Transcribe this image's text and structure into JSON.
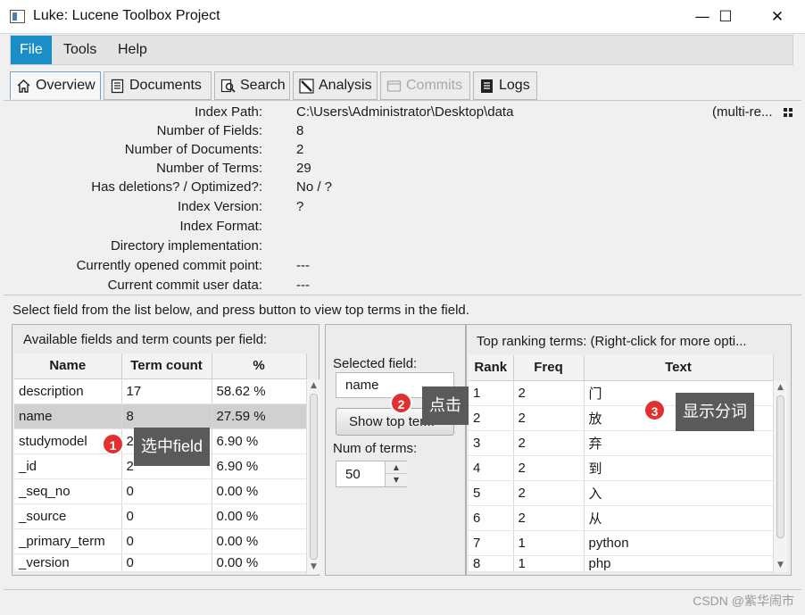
{
  "window": {
    "title": "Luke: Lucene Toolbox Project",
    "minimize_glyph": "—",
    "maximize_glyph": "☐",
    "close_glyph": "✕"
  },
  "menu": {
    "items": [
      {
        "label": "File",
        "active": true
      },
      {
        "label": "Tools"
      },
      {
        "label": "Help"
      }
    ]
  },
  "tabs": [
    {
      "label": "Overview",
      "icon": "home-icon",
      "selected": true
    },
    {
      "label": "Documents",
      "icon": "document-icon"
    },
    {
      "label": "Search",
      "icon": "search-icon"
    },
    {
      "label": "Analysis",
      "icon": "wand-icon"
    },
    {
      "label": "Commits",
      "icon": "commit-icon",
      "disabled": true
    },
    {
      "label": "Logs",
      "icon": "log-icon"
    }
  ],
  "overview": {
    "multi_reader": "(multi-re...",
    "fields": [
      {
        "label": "Index Path:",
        "value": "C:\\Users\\Administrator\\Desktop\\data"
      },
      {
        "label": "Number of Fields:",
        "value": "8"
      },
      {
        "label": "Number of Documents:",
        "value": "2"
      },
      {
        "label": "Number of Terms:",
        "value": "29"
      },
      {
        "label": "Has deletions? / Optimized?:",
        "value": "No / ?"
      },
      {
        "label": "Index Version:",
        "value": "?"
      },
      {
        "label": "Index Format:",
        "value": ""
      },
      {
        "label": "Directory implementation:",
        "value": ""
      },
      {
        "label": "Currently opened commit point:",
        "value": "---"
      },
      {
        "label": "Current commit user data:",
        "value": "---"
      }
    ]
  },
  "instruction": "Select field from the list below, and press button to view top terms in the field.",
  "fields_pane": {
    "title": "Available fields and term counts per field:",
    "columns": [
      "Name",
      "Term count",
      "%"
    ],
    "rows": [
      {
        "name": "description",
        "count": "17",
        "pct": "58.62 %"
      },
      {
        "name": "name",
        "count": "8",
        "pct": "27.59 %",
        "selected": true
      },
      {
        "name": "studymodel",
        "count": "2",
        "pct": "6.90 %"
      },
      {
        "name": "_id",
        "count": "2",
        "pct": "6.90 %"
      },
      {
        "name": "_seq_no",
        "count": "0",
        "pct": "0.00 %"
      },
      {
        "name": "_source",
        "count": "0",
        "pct": "0.00 %"
      },
      {
        "name": "_primary_term",
        "count": "0",
        "pct": "0.00 %"
      },
      {
        "name": "_version",
        "count": "0",
        "pct": "0.00 %"
      }
    ]
  },
  "middle_pane": {
    "selected_field_label": "Selected field:",
    "selected_field_value": "name",
    "show_button_label": "Show top ter...",
    "num_terms_label": "Num of terms:",
    "num_terms_value": "50"
  },
  "terms_pane": {
    "title": "Top ranking terms: (Right-click for more opti...",
    "columns": [
      "Rank",
      "Freq",
      "Text"
    ],
    "rows": [
      {
        "rank": "1",
        "freq": "2",
        "text": "门"
      },
      {
        "rank": "2",
        "freq": "2",
        "text": "放"
      },
      {
        "rank": "3",
        "freq": "2",
        "text": "弃"
      },
      {
        "rank": "4",
        "freq": "2",
        "text": "到"
      },
      {
        "rank": "5",
        "freq": "2",
        "text": "入"
      },
      {
        "rank": "6",
        "freq": "2",
        "text": "从"
      },
      {
        "rank": "7",
        "freq": "1",
        "text": "python"
      },
      {
        "rank": "8",
        "freq": "1",
        "text": "php"
      }
    ]
  },
  "callouts": [
    {
      "number": "1",
      "text": "选中field"
    },
    {
      "number": "2",
      "text": "点击"
    },
    {
      "number": "3",
      "text": "显示分词"
    }
  ],
  "watermark": "CSDN @紫华闹市",
  "colors": {
    "accent": "#1a8ec7",
    "callout": "#e1302f",
    "callout_label_bg": "#5a5a5a"
  }
}
